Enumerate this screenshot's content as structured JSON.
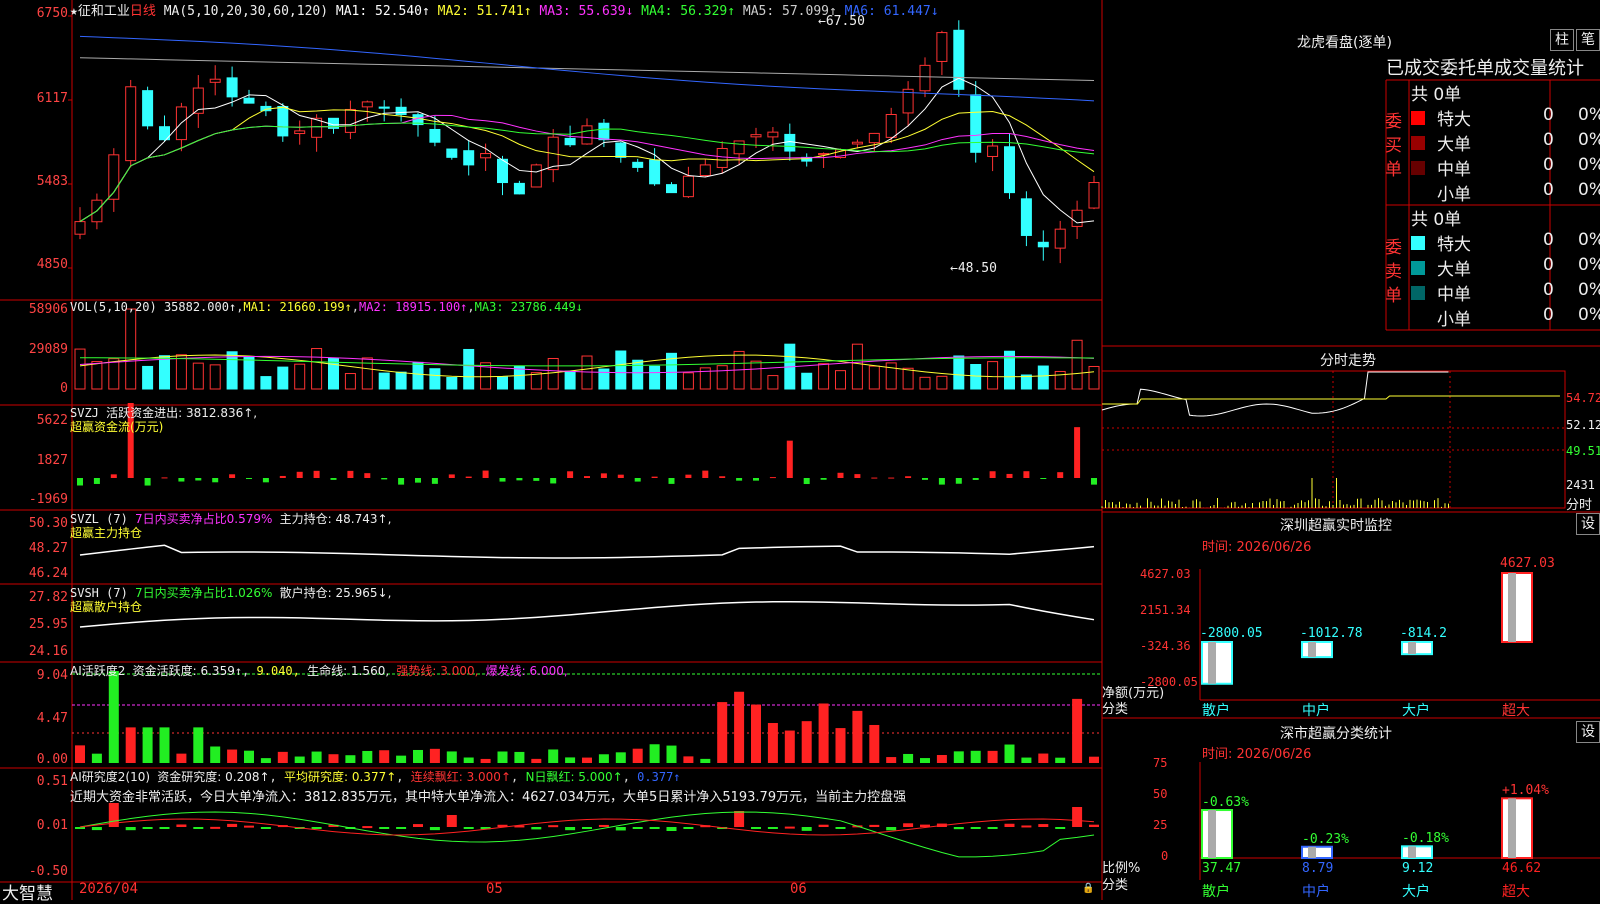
{
  "title_bar": {
    "star": "★",
    "stock_name": "征和工业",
    "period": "日线",
    "ma_spec": "MA(5,10,20,30,60,120)",
    "ma": [
      {
        "label": "MA1: 52.540↑",
        "color": "#ffffff"
      },
      {
        "label": "MA2: 51.741↑",
        "color": "#ffff33"
      },
      {
        "label": "MA3: 55.639↓",
        "color": "#ff33ff"
      },
      {
        "label": "MA4: 56.329↑",
        "color": "#33ff33"
      },
      {
        "label": "MA5: 57.099↑",
        "color": "#cccccc"
      },
      {
        "label": "MA6: 61.447↓",
        "color": "#3366ff"
      }
    ]
  },
  "price_axis": [
    "6750",
    "6117",
    "5483",
    "4850"
  ],
  "price_annotations": {
    "high": "←67.50",
    "low": "←48.50"
  },
  "vol_pane": {
    "spec": "VOL(5,10,20)",
    "value": "35882.000↑",
    "ma1": "MA1: 21660.199↑",
    "ma2": "MA2: 18915.100↑",
    "ma3": "MA3: 23786.449↓",
    "axis": [
      "58906",
      "29089",
      "0"
    ]
  },
  "svzj_pane": {
    "name": "SVZJ",
    "label": "活跃资金进出: 3812.836↑,",
    "sub": "超赢资金流(万元)",
    "axis": [
      "5622",
      "1827",
      "-1969"
    ]
  },
  "svzl_pane": {
    "spec": "SVZL (7)",
    "ratio": "7日内买卖净占比0.579%",
    "hold": "主力持仓: 48.743↑,",
    "sub": "超赢主力持仓",
    "axis": [
      "50.30",
      "48.27",
      "46.24"
    ]
  },
  "svsh_pane": {
    "spec": "SVSH (7)",
    "ratio": "7日内买卖净占比1.026%",
    "hold": "散户持仓: 25.965↓,",
    "sub": "超赢散户持仓",
    "axis": [
      "27.82",
      "25.95",
      "24.16"
    ]
  },
  "ai_active_pane": {
    "name": "AI活跃度2",
    "activity": "资金活跃度: 6.359",
    "v2": "9.040,",
    "life": "生命线: 1.560,",
    "strong": "强势线: 3.000,",
    "burst": "爆发线: 6.000,",
    "axis": [
      "9.04",
      "4.47",
      "0.00"
    ]
  },
  "ai_research_pane": {
    "name": "AI研究度2(10)",
    "research": "资金研究度: 0.208↑",
    "avg": "平均研究度: 0.377↑",
    "cont_red": "连续飘红: 3.000↑",
    "n_red": "N日飘红: 5.000↑",
    "last": "0.377↑",
    "commentary": "近期大资金非常活跃，今日大单净流入：3812.835万元，其中特大单净流入：4627.034万元，大单5日累计净入5193.79万元，当前主力控盘强",
    "axis": [
      "0.51",
      "0.01",
      "-0.50"
    ]
  },
  "x_axis": {
    "start": "2026/04",
    "m1": "05",
    "m2": "06"
  },
  "bottom_brand": "大智慧",
  "lhb": {
    "title": "龙虎看盘(逐单)",
    "btn1": "柱",
    "btn2": "笔",
    "heading": "已成交委托单成交量统计",
    "buy_group": "委买单",
    "sell_group": "委卖单",
    "buy_total": "共 0单",
    "sell_total": "共 0单",
    "buy_rows": [
      {
        "label": "特大",
        "vol": "0",
        "pct": "0%",
        "color": "#ff0000"
      },
      {
        "label": "大单",
        "vol": "0",
        "pct": "0%",
        "color": "#990000"
      },
      {
        "label": "中单",
        "vol": "0",
        "pct": "0%",
        "color": "#660000"
      },
      {
        "label": "小单",
        "vol": "0",
        "pct": "0%",
        "color": "#000000"
      }
    ],
    "sell_rows": [
      {
        "label": "特大",
        "vol": "0",
        "pct": "0%",
        "color": "#33ffff"
      },
      {
        "label": "大单",
        "vol": "0",
        "pct": "0%",
        "color": "#009999"
      },
      {
        "label": "中单",
        "vol": "0",
        "pct": "0%",
        "color": "#006666"
      },
      {
        "label": "小单",
        "vol": "0",
        "pct": "0%",
        "color": "#000000"
      }
    ]
  },
  "intraday": {
    "title": "分时走势",
    "axis": [
      "54.72",
      "52.12",
      "49.51",
      "2431"
    ],
    "vol_label": "分时"
  },
  "monitor": {
    "title": "深圳超赢实时监控",
    "btn": "设",
    "date": "时间: 2026/06/26",
    "axis": [
      "4627.03",
      "2151.34",
      "-324.36",
      "-2800.05"
    ],
    "unit": "净额(万元)",
    "cat_label": "分类",
    "bars": [
      {
        "cat": "散户",
        "value": "-2800.05",
        "num": -2800.05
      },
      {
        "cat": "中户",
        "value": "-1012.78",
        "num": -1012.78
      },
      {
        "cat": "大户",
        "value": "-814.2",
        "num": -814.2
      },
      {
        "cat": "超大",
        "value": "4627.03",
        "num": 4627.03
      }
    ]
  },
  "classify": {
    "title": "深市超赢分类统计",
    "btn": "设",
    "date": "时间: 2026/06/26",
    "axis": [
      "75",
      "50",
      "25",
      "0"
    ],
    "unit": "比例%",
    "cat_label": "分类",
    "bars": [
      {
        "cat": "散户",
        "pct": 37.47,
        "pct_label": "37.47",
        "diff": "-0.63%"
      },
      {
        "cat": "中户",
        "pct": 8.79,
        "pct_label": "8.79",
        "diff": "-0.23%"
      },
      {
        "cat": "大户",
        "pct": 9.12,
        "pct_label": "9.12",
        "diff": "-0.18%"
      },
      {
        "cat": "超大",
        "pct": 46.62,
        "pct_label": "46.62",
        "diff": "+1.04%"
      }
    ]
  }
}
